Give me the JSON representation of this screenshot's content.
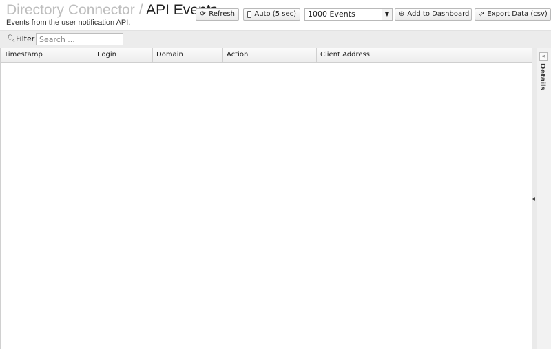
{
  "header": {
    "breadcrumb": "Directory Connector",
    "separator": "/",
    "title": "API Events",
    "subtitle": "Events from the user notification API."
  },
  "toolbar": {
    "refresh_label": "Refresh",
    "refresh_icon": "refresh-icon",
    "auto_label": "Auto (5 sec)",
    "events_selected": "1000 Events",
    "add_dashboard_label": "Add to Dashboard",
    "add_dashboard_icon": "plus-circle-icon",
    "export_label": "Export Data (csv)",
    "export_icon": "export-icon"
  },
  "filter": {
    "label": "Filter",
    "icon": "search-icon",
    "placeholder": "Search ..."
  },
  "table": {
    "columns": [
      "Timestamp",
      "Login",
      "Domain",
      "Action",
      "Client Address"
    ],
    "rows": []
  },
  "details_panel": {
    "label": "Details",
    "collapse_icon": "double-chevron-left-icon"
  }
}
